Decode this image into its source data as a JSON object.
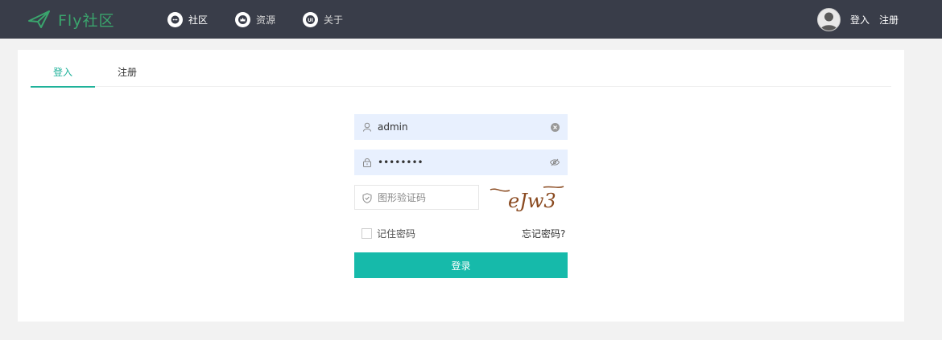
{
  "header": {
    "logo_text": "Fly社区",
    "nav": [
      {
        "label": "社区",
        "icon": "chat-bubble-icon"
      },
      {
        "label": "资源",
        "icon": "crown-icon"
      },
      {
        "label": "关于",
        "icon": "ui-badge-icon"
      }
    ],
    "login_label": "登入",
    "register_label": "注册"
  },
  "tabs": {
    "login": "登入",
    "register": "注册",
    "active": "login"
  },
  "form": {
    "username": {
      "value": "admin",
      "icon": "user-icon",
      "action_icon": "clear-icon"
    },
    "password": {
      "value": "••••••••",
      "icon": "lock-icon",
      "action_icon": "eye-icon"
    },
    "captcha": {
      "placeholder": "图形验证码",
      "icon": "shield-icon",
      "image_text": "eJw3"
    },
    "remember_label": "记住密码",
    "remember_checked": false,
    "forgot_label": "忘记密码?",
    "submit_label": "登录"
  },
  "colors": {
    "header_bg": "#393d49",
    "accent": "#16baaa",
    "logo": "#3aa56d",
    "field_bg": "#e8f0fe",
    "page_bg": "#f2f2f2"
  }
}
